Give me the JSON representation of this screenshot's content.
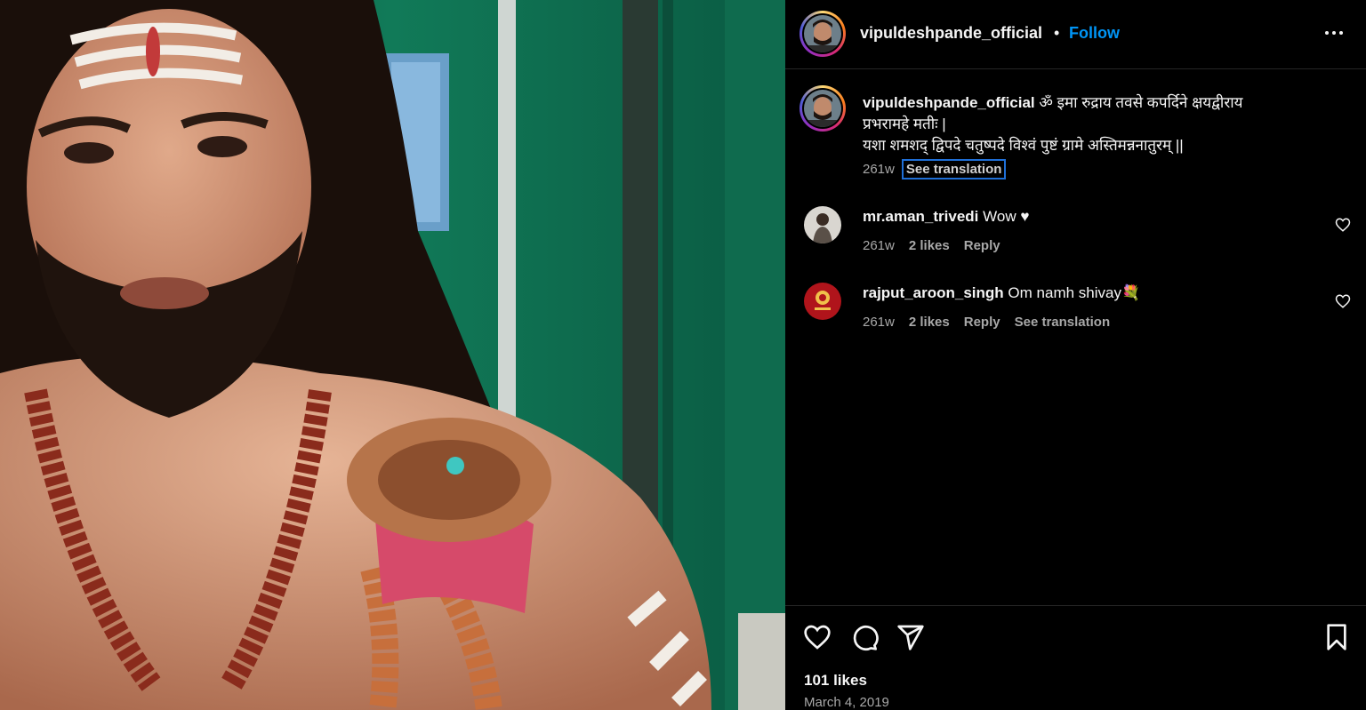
{
  "post": {
    "username": "vipuldeshpande_official",
    "separator": "•",
    "follow_label": "Follow",
    "more_icon": "more-options-icon"
  },
  "caption": {
    "username": "vipuldeshpande_official",
    "line1": "ॐ इमा रुद्राय तवसे कपर्दिने क्षयद्वीराय",
    "line2": "प्रभरामहे मतीः |",
    "line3": "यशा शमशद् द्विपदे चतुष्पदे विश्वं पुष्टं ग्रामे अस्तिमन्ननातुरम् ||",
    "time": "261w",
    "see_translation": "See translation"
  },
  "comments": [
    {
      "username": "mr.aman_trivedi",
      "text": "Wow ♥",
      "time": "261w",
      "likes": "2 likes",
      "reply": "Reply"
    },
    {
      "username": "rajput_aroon_singh",
      "text": "Om namh shivay💐",
      "time": "261w",
      "likes": "2 likes",
      "reply": "Reply",
      "see_translation": "See translation"
    }
  ],
  "footer": {
    "likes": "101 likes",
    "date": "March 4, 2019"
  },
  "icons": [
    "heart-icon",
    "comment-icon",
    "share-icon",
    "bookmark-icon"
  ],
  "colors": {
    "background": "#000000",
    "accent": "#0095f6",
    "muted": "#a8a8a8",
    "focus_ring": "#1f6fd6"
  }
}
